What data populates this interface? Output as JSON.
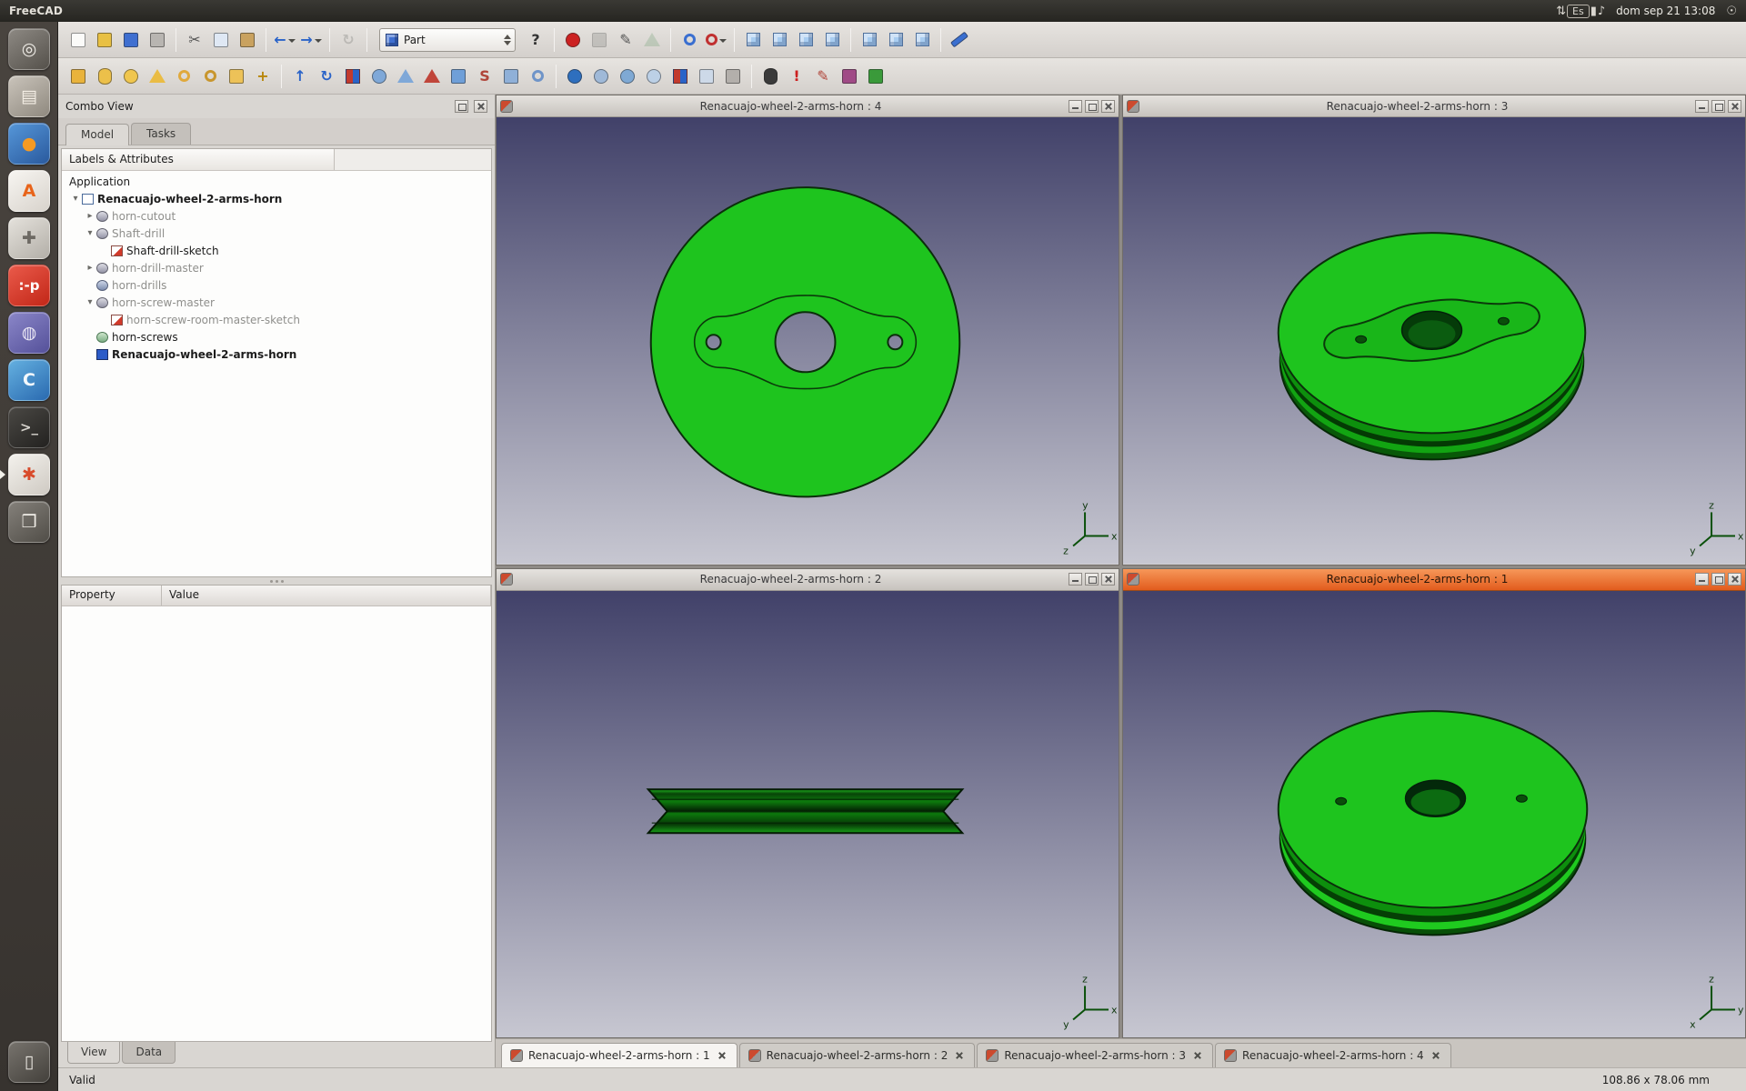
{
  "top_bar": {
    "app_title": "FreeCAD",
    "indicators": [
      {
        "name": "network",
        "glyph": "⇅"
      },
      {
        "name": "keyboard-layout",
        "glyph": "Es",
        "boxed": true
      },
      {
        "name": "battery",
        "glyph": "▮"
      },
      {
        "name": "volume",
        "glyph": "♪"
      }
    ],
    "clock": "dom sep 21 13:08",
    "indicators_right": [
      {
        "name": "session-menu",
        "glyph": "☉"
      }
    ]
  },
  "launcher": {
    "items": [
      {
        "name": "dash-home",
        "glyph": "◎",
        "fg": "#efece6",
        "bg": [
          "#8d8983",
          "#55514b"
        ]
      },
      {
        "name": "files",
        "glyph": "▤",
        "fg": "#f5efe6",
        "bg": [
          "#c9c3ba",
          "#8f897f"
        ]
      },
      {
        "name": "firefox",
        "glyph": "●",
        "fg": "#f59a23",
        "bg": [
          "#5596d8",
          "#2a5a9e"
        ]
      },
      {
        "name": "software-center",
        "glyph": "A",
        "fg": "#e8641a",
        "bg": [
          "#f7f5f1",
          "#d8d3cc"
        ]
      },
      {
        "name": "system-settings",
        "glyph": "✚",
        "fg": "#6d6963",
        "bg": [
          "#e4e1db",
          "#b3afa8"
        ]
      },
      {
        "name": "chat-app",
        "glyph": ":-p",
        "fg": "#ffffff",
        "bg": [
          "#ea5a4a",
          "#c22718"
        ]
      },
      {
        "name": "ubuntu-one",
        "glyph": "◍",
        "fg": "#ece9f5",
        "bg": [
          "#8a86c8",
          "#55519a"
        ]
      },
      {
        "name": "music-player",
        "glyph": "C",
        "fg": "#f3f8fc",
        "bg": [
          "#64b0e0",
          "#2a6ab0"
        ]
      },
      {
        "name": "terminal",
        "glyph": ">_",
        "fg": "#d6d3cd",
        "bg": [
          "#4a4844",
          "#232220"
        ]
      },
      {
        "name": "freecad",
        "glyph": "✱",
        "fg": "#d84a2a",
        "bg": [
          "#f3f1ec",
          "#cfcac3"
        ],
        "active": true
      },
      {
        "name": "window-stack",
        "glyph": "❒",
        "fg": "#efece6",
        "bg": [
          "#84807a",
          "#514e48"
        ]
      },
      {
        "name": "trash",
        "glyph": "▯",
        "fg": "#e8e5df",
        "bg": [
          "#77736d",
          "#44413c"
        ],
        "bottom": true
      }
    ]
  },
  "toolbars": {
    "workbench_value": "Part",
    "row1_left": [
      {
        "name": "new-document",
        "shape": "square",
        "color": "#fbfbf9"
      },
      {
        "name": "open-document",
        "shape": "square",
        "color": "#e8c043"
      },
      {
        "name": "save-document",
        "shape": "square",
        "color": "#3f6fd0"
      },
      {
        "name": "print-document",
        "shape": "square",
        "color": "#b8b5b1"
      },
      {
        "sep": true
      },
      {
        "name": "cut",
        "char": "✂",
        "color": "#555555"
      },
      {
        "name": "copy",
        "shape": "square",
        "color": "#dfe8f4"
      },
      {
        "name": "paste",
        "shape": "square",
        "color": "#c9a25f"
      },
      {
        "sep": true
      },
      {
        "name": "undo",
        "char": "←",
        "color": "#2a63c8",
        "caret": true
      },
      {
        "name": "redo",
        "char": "→",
        "color": "#2a63c8",
        "caret": true
      },
      {
        "sep": true
      },
      {
        "name": "refresh",
        "char": "↻",
        "color": "#8a8a86",
        "disabled": true
      },
      {
        "sep": true
      }
    ],
    "row1_right": [
      {
        "name": "whats-this",
        "char": "?",
        "color": "#333333"
      },
      {
        "sep": true
      },
      {
        "name": "macro-record",
        "shape": "circle",
        "color": "#cc2222"
      },
      {
        "name": "macro-stop",
        "shape": "square",
        "color": "#9a9a96",
        "disabled": true
      },
      {
        "name": "macro-edit",
        "char": "✎",
        "color": "#555555"
      },
      {
        "name": "macro-execute",
        "shape": "triangle",
        "color": "#8fae8f",
        "disabled": true
      },
      {
        "sep": true
      },
      {
        "name": "view-fit-all",
        "shape": "ring",
        "color": "#3a6fd0"
      },
      {
        "name": "draw-style",
        "shape": "ring",
        "color": "#c03030",
        "caret": true
      },
      {
        "sep": true
      },
      {
        "name": "view-isometric",
        "shape": "cube"
      },
      {
        "name": "view-front",
        "shape": "cube"
      },
      {
        "name": "view-top",
        "shape": "cube"
      },
      {
        "name": "view-right",
        "shape": "cube"
      },
      {
        "sep": true
      },
      {
        "name": "view-rear",
        "shape": "cube"
      },
      {
        "name": "view-bottom",
        "shape": "cube"
      },
      {
        "name": "view-left",
        "shape": "cube"
      },
      {
        "sep": true
      },
      {
        "name": "measure-distance",
        "shape": "bar",
        "color": "#3a6fd0"
      }
    ],
    "row2": [
      {
        "name": "part-box",
        "shape": "square",
        "color": "#e9b33c"
      },
      {
        "name": "part-cylinder",
        "shape": "capsule",
        "color": "#ecc04a"
      },
      {
        "name": "part-sphere",
        "shape": "circle",
        "color": "#f0c64e"
      },
      {
        "name": "part-cone",
        "shape": "triangle",
        "color": "#eabc44"
      },
      {
        "name": "part-torus",
        "shape": "ring",
        "color": "#e0a93c"
      },
      {
        "name": "part-tube",
        "shape": "ring",
        "color": "#c8962e"
      },
      {
        "name": "part-create-primitives",
        "shape": "square",
        "color": "#edc258"
      },
      {
        "name": "part-shape-builder",
        "char": "+",
        "color": "#b8860b"
      },
      {
        "sep": true
      },
      {
        "name": "part-extrude",
        "char": "↑",
        "color": "#2a63c8"
      },
      {
        "name": "part-revolve",
        "char": "↻",
        "color": "#2a63c8"
      },
      {
        "name": "part-mirror",
        "shape": "duo"
      },
      {
        "name": "part-fillet",
        "shape": "circle",
        "color": "#7fa8d8"
      },
      {
        "name": "part-chamfer",
        "shape": "triangle",
        "color": "#7fa8d8"
      },
      {
        "name": "part-ruled-surface",
        "shape": "triangle",
        "color": "#c0453a"
      },
      {
        "name": "part-loft",
        "shape": "square",
        "color": "#6f9fd8"
      },
      {
        "name": "part-sweep",
        "char": "S",
        "color": "#b0453a"
      },
      {
        "name": "part-offset",
        "shape": "square",
        "color": "#8fb0d8"
      },
      {
        "name": "part-thickness",
        "shape": "ring",
        "color": "#6f94c8"
      },
      {
        "sep": true
      },
      {
        "name": "part-boolean",
        "shape": "circle",
        "color": "#2e6fbe"
      },
      {
        "name": "part-cut",
        "shape": "circle",
        "color": "#9fb9d8"
      },
      {
        "name": "part-union",
        "shape": "circle",
        "color": "#7fa9d4"
      },
      {
        "name": "part-intersection",
        "shape": "circle",
        "color": "#bcd0e6"
      },
      {
        "name": "part-section",
        "shape": "duo"
      },
      {
        "name": "part-cross-sections",
        "shape": "square",
        "color": "#cdd9e8"
      },
      {
        "name": "part-compound",
        "shape": "square",
        "color": "#b3afab"
      },
      {
        "sep": true
      },
      {
        "name": "part-appearance",
        "shape": "capsule",
        "color": "#3a3a3a"
      },
      {
        "name": "part-check-geometry",
        "char": "!",
        "color": "#cc2020"
      },
      {
        "name": "part-defeaturing",
        "char": "✎",
        "color": "#b0453a"
      },
      {
        "name": "part-refine-shape",
        "shape": "square",
        "color": "#a04a86"
      },
      {
        "name": "part-migrate",
        "shape": "square",
        "color": "#3a9a3a"
      }
    ]
  },
  "combo_view": {
    "title": "Combo View",
    "tabs": [
      {
        "label": "Model",
        "active": true
      },
      {
        "label": "Tasks",
        "active": false
      }
    ],
    "tree_header": "Labels & Attributes",
    "tree": [
      {
        "label": "Application",
        "level": 0,
        "arrow": "none",
        "icon": "none",
        "muted": false,
        "bold": false
      },
      {
        "label": "Renacuajo-wheel-2-arms-horn",
        "level": 0,
        "arrow": "down",
        "icon": "document",
        "muted": false,
        "bold": true
      },
      {
        "label": "horn-cutout",
        "level": 1,
        "arrow": "right",
        "icon": "feature",
        "muted": true,
        "bold": false
      },
      {
        "label": "Shaft-drill",
        "level": 1,
        "arrow": "down",
        "icon": "feature",
        "muted": true,
        "bold": false
      },
      {
        "label": "Shaft-drill-sketch",
        "level": 2,
        "arrow": "none",
        "icon": "sketch",
        "muted": false,
        "bold": false
      },
      {
        "label": "horn-drill-master",
        "level": 1,
        "arrow": "right",
        "icon": "feature",
        "muted": true,
        "bold": false
      },
      {
        "label": "horn-drills",
        "level": 1,
        "arrow": "none",
        "icon": "drill",
        "muted": true,
        "bold": false
      },
      {
        "label": "horn-screw-master",
        "level": 1,
        "arrow": "down",
        "icon": "feature",
        "muted": true,
        "bold": false
      },
      {
        "label": "horn-screw-room-master-sketch",
        "level": 2,
        "arrow": "none",
        "icon": "sketch",
        "muted": true,
        "bold": false
      },
      {
        "label": "horn-screws",
        "level": 1,
        "arrow": "none",
        "icon": "screws",
        "muted": false,
        "bold": false
      },
      {
        "label": "Renacuajo-wheel-2-arms-horn",
        "level": 1,
        "arrow": "none",
        "icon": "part",
        "muted": false,
        "bold": true
      }
    ],
    "property_columns": [
      "Property",
      "Value"
    ],
    "bottom_tabs": [
      {
        "label": "View",
        "active": true
      },
      {
        "label": "Data",
        "active": false
      }
    ]
  },
  "viewports": [
    {
      "title": "Renacuajo-wheel-2-arms-horn : 4",
      "active": false,
      "axes": {
        "up": "y",
        "right": "x",
        "diag": "z"
      }
    },
    {
      "title": "Renacuajo-wheel-2-arms-horn : 3",
      "active": false,
      "axes": {
        "up": "z",
        "right": "x",
        "diag": "y"
      }
    },
    {
      "title": "Renacuajo-wheel-2-arms-horn : 2",
      "active": false,
      "axes": {
        "up": "z",
        "right": "x",
        "diag": "y"
      }
    },
    {
      "title": "Renacuajo-wheel-2-arms-horn : 1",
      "active": true,
      "axes": {
        "up": "z",
        "right": "y",
        "diag": "x"
      }
    }
  ],
  "mdi_tabs": [
    {
      "label": "Renacuajo-wheel-2-arms-horn : 1",
      "active": true
    },
    {
      "label": "Renacuajo-wheel-2-arms-horn : 2",
      "active": false
    },
    {
      "label": "Renacuajo-wheel-2-arms-horn : 3",
      "active": false
    },
    {
      "label": "Renacuajo-wheel-2-arms-horn : 4",
      "active": false
    }
  ],
  "status_bar": {
    "message": "Valid",
    "dimensions": "108.86 x 78.06 mm"
  },
  "colors": {
    "part_green": "#1ec41e",
    "active_titlebar": "#ec6a32",
    "viewport_gradient_top": "#414169",
    "viewport_gradient_bottom": "#c7c7d1"
  }
}
